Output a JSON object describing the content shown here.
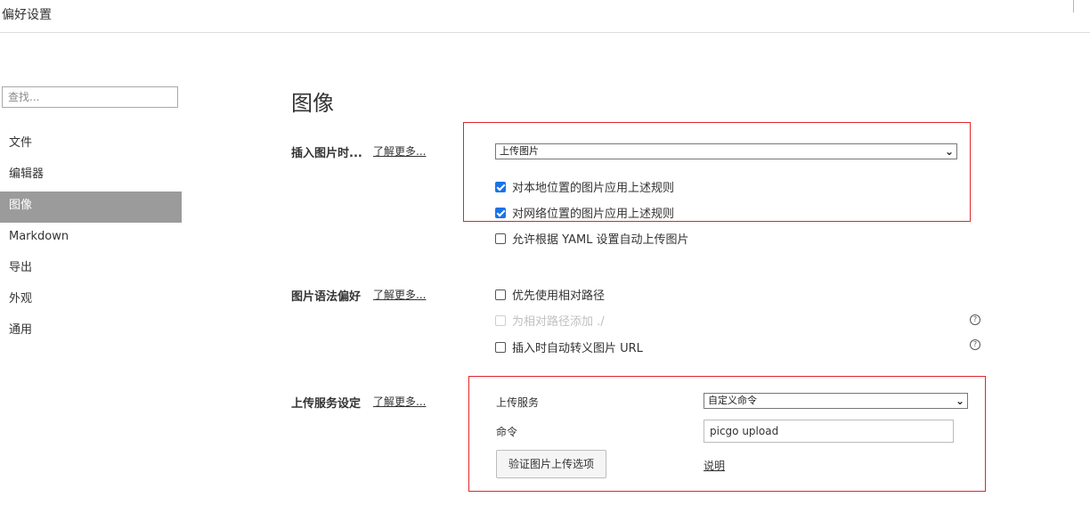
{
  "window": {
    "title": "偏好设置"
  },
  "sidebar": {
    "search_placeholder": "查找...",
    "items": [
      {
        "label": "文件"
      },
      {
        "label": "编辑器"
      },
      {
        "label": "图像"
      },
      {
        "label": "Markdown"
      },
      {
        "label": "导出"
      },
      {
        "label": "外观"
      },
      {
        "label": "通用"
      }
    ],
    "active_index": 2
  },
  "main": {
    "title": "图像",
    "insert": {
      "label": "插入图片时...",
      "learn_more": "了解更多...",
      "select_value": "上传图片",
      "options": [
        {
          "label": "对本地位置的图片应用上述规则",
          "checked": true
        },
        {
          "label": "对网络位置的图片应用上述规则",
          "checked": true
        },
        {
          "label": "允许根据 YAML 设置自动上传图片",
          "checked": false
        }
      ]
    },
    "syntax": {
      "label": "图片语法偏好",
      "learn_more": "了解更多...",
      "options": [
        {
          "label": "优先使用相对路径",
          "checked": false
        },
        {
          "label": "为相对路径添加 ./",
          "checked": false,
          "disabled": true
        },
        {
          "label": "插入时自动转义图片 URL",
          "checked": false
        }
      ],
      "help_icon": "?"
    },
    "upload": {
      "label": "上传服务设定",
      "learn_more": "了解更多...",
      "service_label": "上传服务",
      "service_value": "自定义命令",
      "command_label": "命令",
      "command_value": "picgo upload",
      "verify_button": "验证图片上传选项",
      "doc_link": "说明"
    }
  },
  "colors": {
    "highlight_box": "#e0262b",
    "active_nav": "#9b9b9b",
    "checkbox": "#1a73e8"
  }
}
